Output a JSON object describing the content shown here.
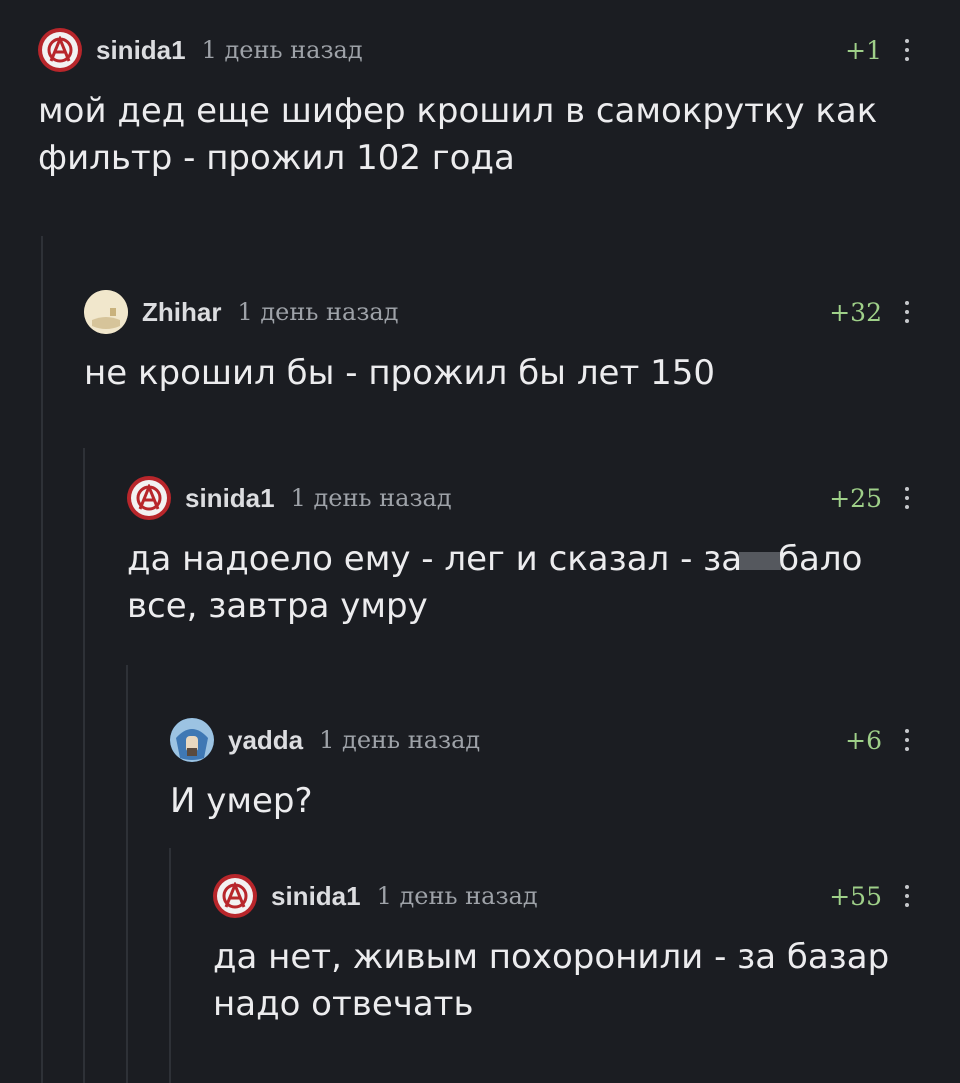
{
  "comments": [
    {
      "username": "sinida1",
      "avatar": "anarchy-icon",
      "time": "1 день назад",
      "score": "+1",
      "text": "мой дед еще шифер крошил в самокрутку как фильтр - прожил 102 года"
    },
    {
      "username": "Zhihar",
      "avatar": "cream-avatar",
      "time": "1 день назад",
      "score": "+32",
      "text": "не крошил бы - прожил бы лет 150"
    },
    {
      "username": "sinida1",
      "avatar": "anarchy-icon",
      "time": "1 день назад",
      "score": "+25",
      "text_before": "да надоело ему - лег и сказал - за",
      "text_after": "бало все, завтра умру"
    },
    {
      "username": "yadda",
      "avatar": "warrior-avatar",
      "time": "1 день назад",
      "score": "+6",
      "text": "И умер?"
    },
    {
      "username": "sinida1",
      "avatar": "anarchy-icon",
      "time": "1 день назад",
      "score": "+55",
      "text": "да нет, живым похоронили - за базар надо отвечать"
    }
  ],
  "colors": {
    "background": "#1b1d22",
    "score": "#9fd089",
    "thread_line": "#2e3137",
    "anarchy_red": "#b8262b"
  }
}
